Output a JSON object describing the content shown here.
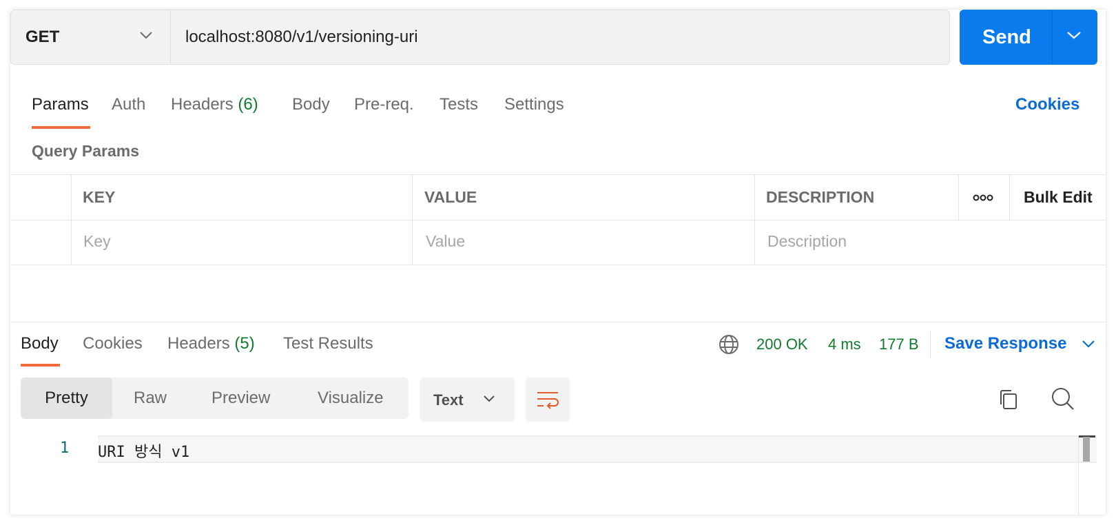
{
  "request": {
    "method": "GET",
    "url": "localhost:8080/v1/versioning-uri",
    "send_label": "Send"
  },
  "request_tabs": {
    "params": "Params",
    "auth": "Auth",
    "headers": "Headers",
    "headers_count": "(6)",
    "body": "Body",
    "prereq": "Pre-req.",
    "tests": "Tests",
    "settings": "Settings",
    "cookies": "Cookies"
  },
  "query_params": {
    "title": "Query Params",
    "columns": {
      "key": "KEY",
      "value": "VALUE",
      "description": "DESCRIPTION",
      "bulk_edit": "Bulk Edit"
    },
    "placeholders": {
      "key": "Key",
      "value": "Value",
      "description": "Description"
    }
  },
  "response_tabs": {
    "body": "Body",
    "cookies": "Cookies",
    "headers": "Headers",
    "headers_count": "(5)",
    "test_results": "Test Results"
  },
  "response_meta": {
    "status": "200 OK",
    "time": "4 ms",
    "size": "177 B",
    "save_response": "Save Response"
  },
  "format": {
    "pretty": "Pretty",
    "raw": "Raw",
    "preview": "Preview",
    "visualize": "Visualize",
    "type": "Text"
  },
  "editor": {
    "line_number": "1",
    "content": "URI 방식 v1"
  },
  "colors": {
    "accent_blue": "#097bed",
    "tab_underline": "#f26b3a",
    "status_green": "#0f7c2b",
    "link_blue": "#0a6bd6"
  }
}
